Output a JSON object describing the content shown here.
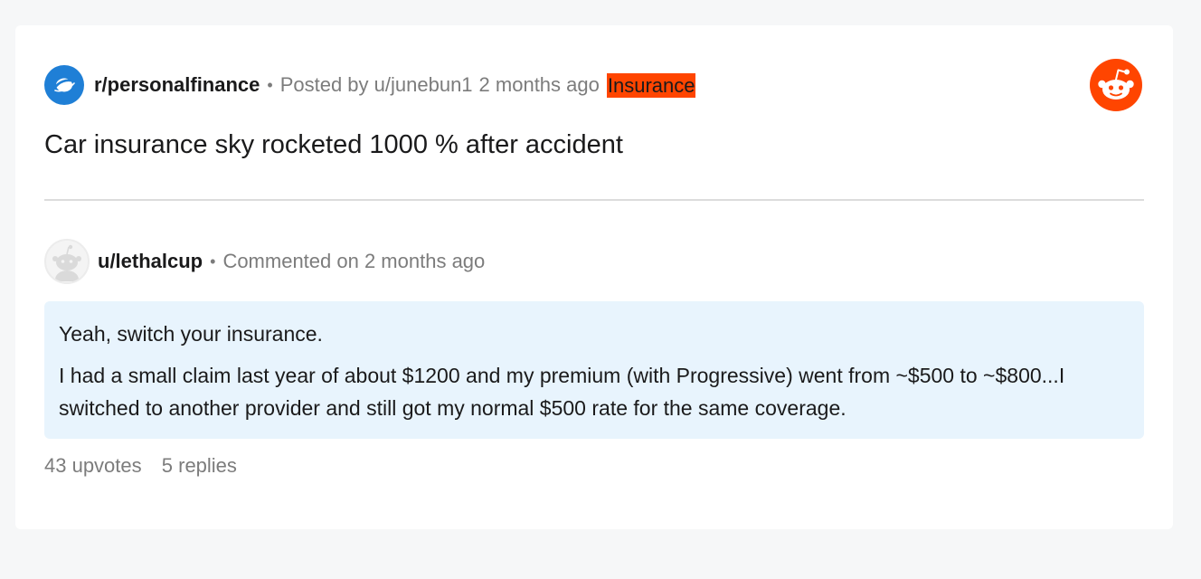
{
  "post": {
    "subreddit": "r/personalfinance",
    "separator": "•",
    "posted_by": "Posted by u/junebun1",
    "time": "2 months ago",
    "flair": "Insurance",
    "title": "Car insurance sky rocketed 1000 % after accident"
  },
  "comment": {
    "username": "u/lethalcup",
    "separator": "•",
    "meta": "Commented on 2 months ago",
    "paragraphs": [
      "Yeah, switch your insurance.",
      "I had a small claim last year of about $1200 and my premium (with Progressive) went from ~$500 to ~$800...I switched to another provider and still got my normal $500 rate for the same coverage."
    ],
    "upvotes": "43 upvotes",
    "replies": "5 replies"
  },
  "icons": {
    "subreddit": "subreddit-planet-icon",
    "brand": "reddit-alien-logo",
    "avatar": "default-user-avatar-icon"
  },
  "colors": {
    "flair_bg": "#ff4500",
    "brand": "#ff4500",
    "subreddit_icon_bg": "#1f7fd6",
    "comment_bg": "#e8f4fd",
    "page_bg": "#f6f7f8",
    "muted_text": "#7c7c7c"
  }
}
